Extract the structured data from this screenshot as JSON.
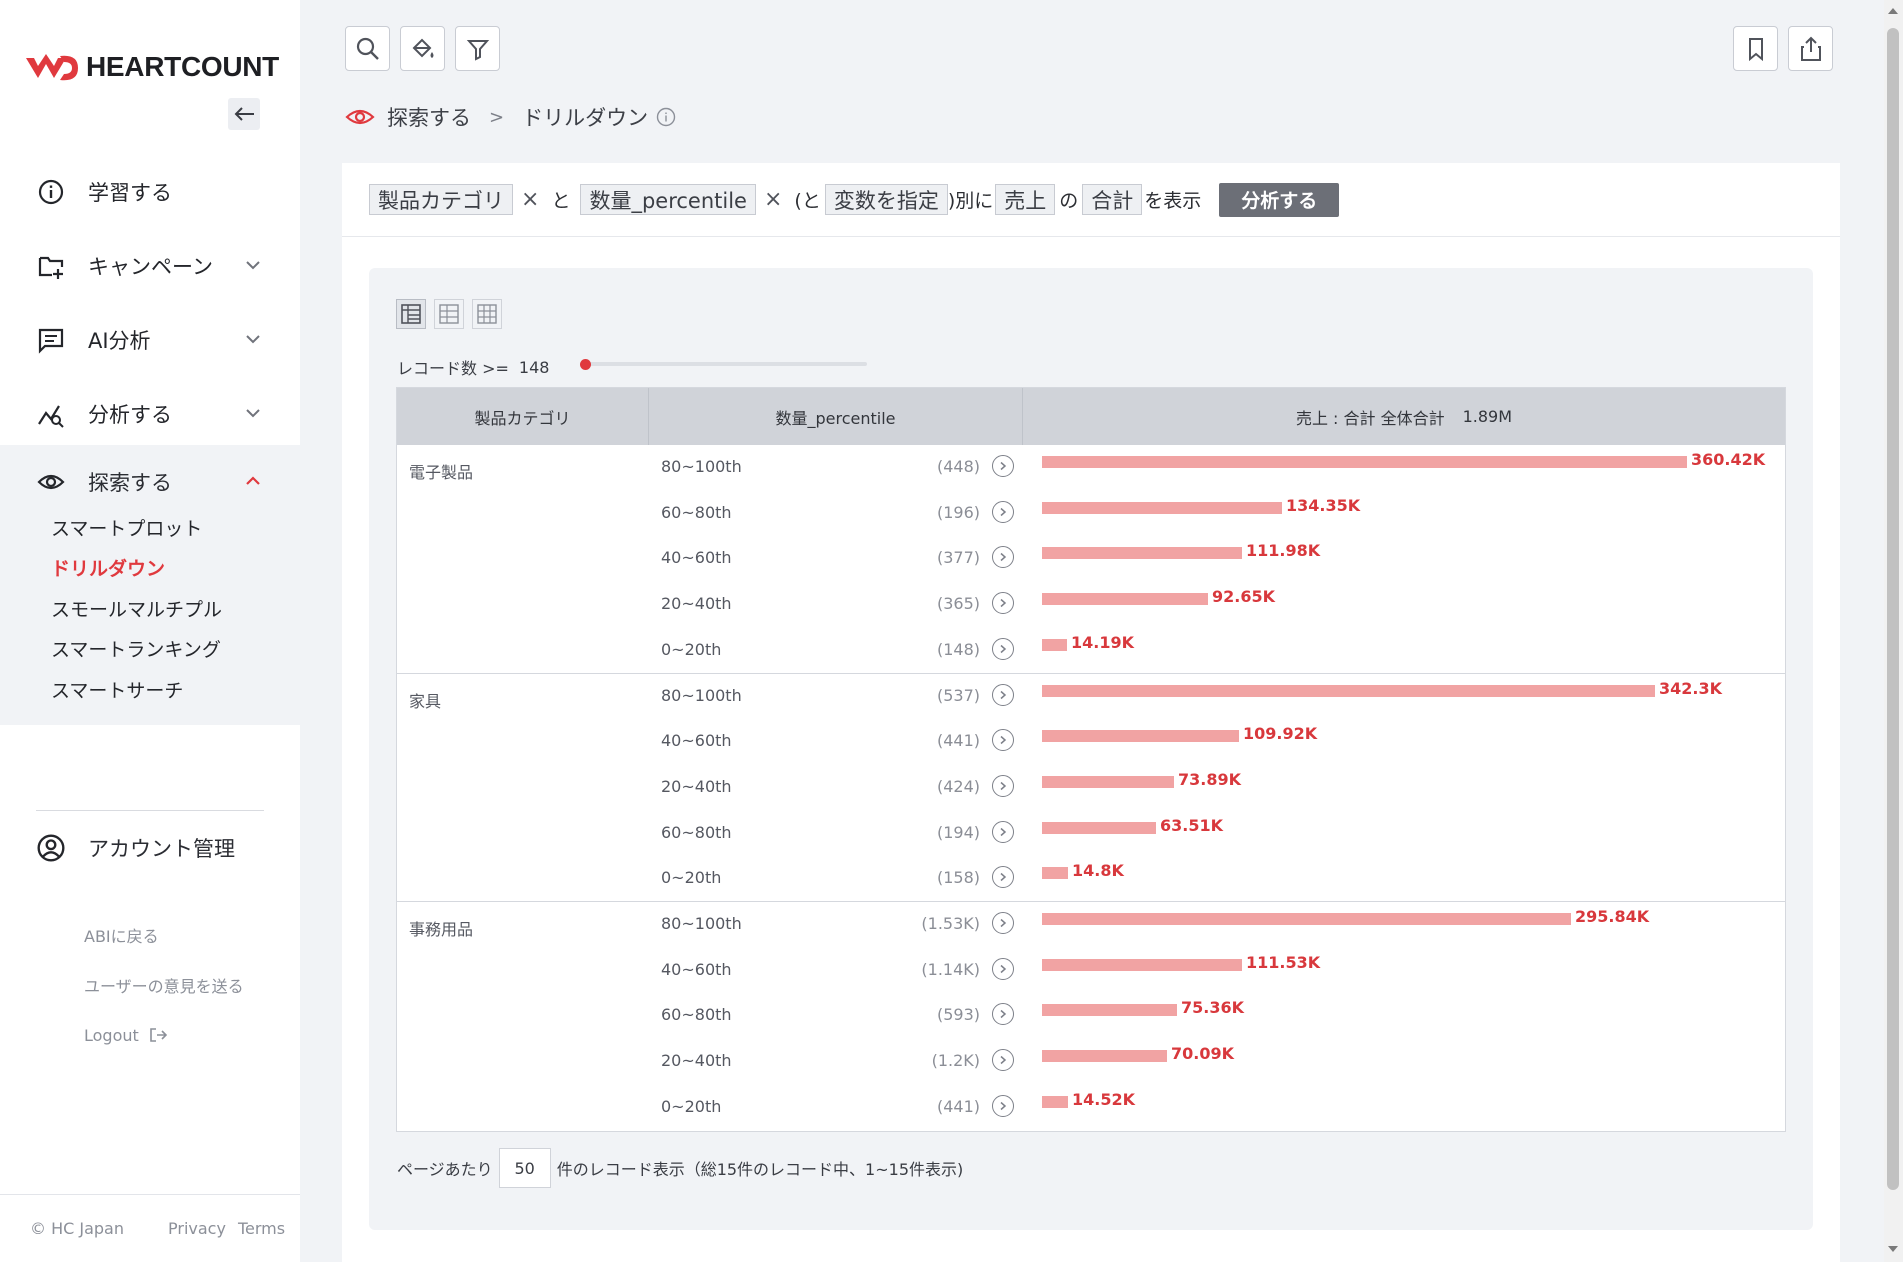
{
  "brand": {
    "name": "HEARTCOUNT",
    "accent": "#e0393e"
  },
  "sidebar": {
    "items": [
      {
        "label": "学習する",
        "icon": "info-icon"
      },
      {
        "label": "キャンペーン",
        "icon": "folder-plus-icon"
      },
      {
        "label": "AI分析",
        "icon": "chat-icon"
      },
      {
        "label": "分析する",
        "icon": "chart-icon"
      }
    ],
    "explore": {
      "label": "探索する",
      "icon": "eye-icon",
      "sub": [
        "スマートプロット",
        "ドリルダウン",
        "スモールマルチプル",
        "スマートランキング",
        "スマートサーチ"
      ],
      "active": "ドリルダウン"
    },
    "account": "アカウント管理",
    "links": [
      "ABIに戻る",
      "ユーザーの意見を送る",
      "Logout"
    ],
    "footer": [
      "© HC Japan",
      "Privacy",
      "Terms"
    ]
  },
  "breadcrumb": {
    "root": "探索する",
    "sep": ">",
    "current": "ドリルダウン"
  },
  "query": {
    "dim1": "製品カテゴリ",
    "and": "と",
    "dim2": "数量_percentile",
    "open": "(と",
    "var": "変数を指定",
    "by": ")別に",
    "measure": "売上",
    "of": "の",
    "agg": "合計",
    "show": "を表示",
    "button": "分析する"
  },
  "filter": {
    "label": "レコード数 >=",
    "value": "148"
  },
  "table": {
    "headers": [
      "製品カテゴリ",
      "数量_percentile",
      "売上 : 合計 全体合計",
      "1.89M"
    ],
    "max_value": 360.42,
    "groups": [
      {
        "category": "電子製品",
        "rows": [
          {
            "pct": "80~100th",
            "count": "(448)",
            "value": 360.42,
            "label": "360.42K"
          },
          {
            "pct": "60~80th",
            "count": "(196)",
            "value": 134.35,
            "label": "134.35K"
          },
          {
            "pct": "40~60th",
            "count": "(377)",
            "value": 111.98,
            "label": "111.98K"
          },
          {
            "pct": "20~40th",
            "count": "(365)",
            "value": 92.65,
            "label": "92.65K"
          },
          {
            "pct": "0~20th",
            "count": "(148)",
            "value": 14.19,
            "label": "14.19K"
          }
        ]
      },
      {
        "category": "家具",
        "rows": [
          {
            "pct": "80~100th",
            "count": "(537)",
            "value": 342.3,
            "label": "342.3K"
          },
          {
            "pct": "40~60th",
            "count": "(441)",
            "value": 109.92,
            "label": "109.92K"
          },
          {
            "pct": "20~40th",
            "count": "(424)",
            "value": 73.89,
            "label": "73.89K"
          },
          {
            "pct": "60~80th",
            "count": "(194)",
            "value": 63.51,
            "label": "63.51K"
          },
          {
            "pct": "0~20th",
            "count": "(158)",
            "value": 14.8,
            "label": "14.8K"
          }
        ]
      },
      {
        "category": "事務用品",
        "rows": [
          {
            "pct": "80~100th",
            "count": "(1.53K)",
            "value": 295.84,
            "label": "295.84K"
          },
          {
            "pct": "40~60th",
            "count": "(1.14K)",
            "value": 111.53,
            "label": "111.53K"
          },
          {
            "pct": "60~80th",
            "count": "(593)",
            "value": 75.36,
            "label": "75.36K"
          },
          {
            "pct": "20~40th",
            "count": "(1.2K)",
            "value": 70.09,
            "label": "70.09K"
          },
          {
            "pct": "0~20th",
            "count": "(441)",
            "value": 14.52,
            "label": "14.52K"
          }
        ]
      }
    ]
  },
  "pager": {
    "prefix": "ページあたり",
    "per_page": "50",
    "suffix": "件のレコード表示（総15件のレコード中、1~15件表示)"
  }
}
